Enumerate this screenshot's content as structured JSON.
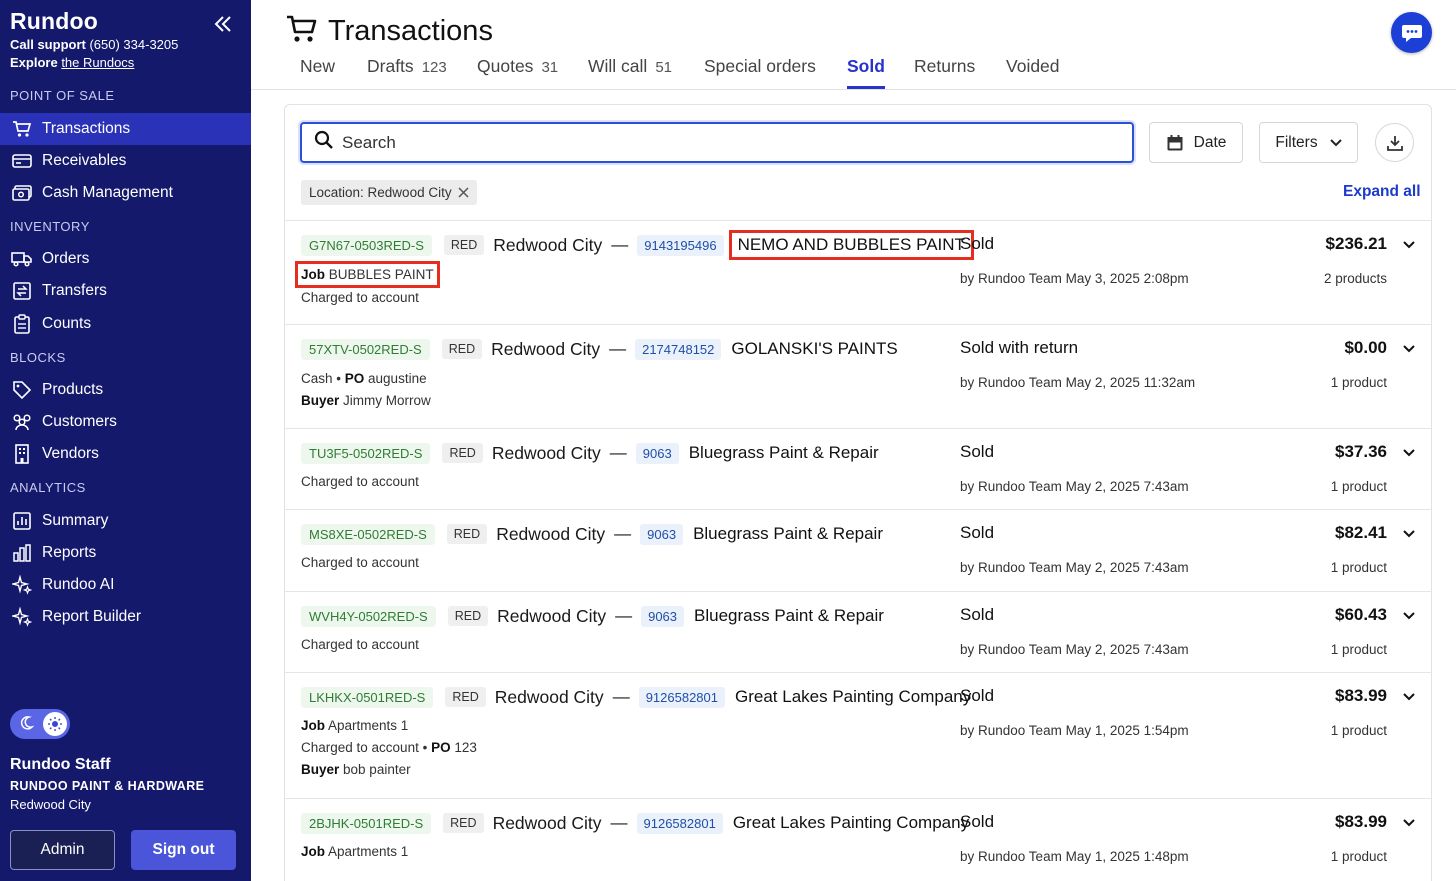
{
  "sidebar": {
    "brand": "Rundoo",
    "support_label": "Call support",
    "support_phone": "(650) 334-3205",
    "explore_label": "Explore",
    "explore_link": "the Rundocs",
    "sections": {
      "pos": "POINT OF SALE",
      "inventory": "INVENTORY",
      "blocks": "BLOCKS",
      "analytics": "ANALYTICS"
    },
    "items": {
      "transactions": "Transactions",
      "receivables": "Receivables",
      "cash": "Cash Management",
      "orders": "Orders",
      "transfers": "Transfers",
      "counts": "Counts",
      "products": "Products",
      "customers": "Customers",
      "vendors": "Vendors",
      "summary": "Summary",
      "reports": "Reports",
      "ai": "Rundoo AI",
      "builder": "Report Builder"
    },
    "user": {
      "name": "Rundoo Staff",
      "company": "RUNDOO PAINT & HARDWARE",
      "location": "Redwood City"
    },
    "admin_label": "Admin",
    "signout_label": "Sign out"
  },
  "header": {
    "title": "Transactions",
    "tabs": [
      {
        "label": "New",
        "count": ""
      },
      {
        "label": "Drafts",
        "count": "123"
      },
      {
        "label": "Quotes",
        "count": "31"
      },
      {
        "label": "Will call",
        "count": "51"
      },
      {
        "label": "Special orders",
        "count": ""
      },
      {
        "label": "Sold",
        "count": ""
      },
      {
        "label": "Returns",
        "count": ""
      },
      {
        "label": "Voided",
        "count": ""
      }
    ]
  },
  "toolbar": {
    "search_placeholder": "Search",
    "date_label": "Date",
    "filters_label": "Filters",
    "chip_label": "Location: Redwood City",
    "expand_label": "Expand all"
  },
  "rows": [
    {
      "id": "G7N67-0503RED-S",
      "loc_code": "RED",
      "loc_name": "Redwood City",
      "acct": "9143195496",
      "customer": "NEMO AND BUBBLES PAINT",
      "line1_label": "Job",
      "line1_value": "BUBBLES PAINT",
      "line2": "Charged to account",
      "status": "Sold",
      "byline": "by Rundoo Team May 3, 2025 2:08pm",
      "amount": "$236.21",
      "products": "2 products"
    },
    {
      "id": "57XTV-0502RED-S",
      "loc_code": "RED",
      "loc_name": "Redwood City",
      "acct": "2174748152",
      "customer": "GOLANSKI'S PAINTS",
      "line1_pre": "Cash • ",
      "line1_label": "PO",
      "line1_value": "augustine",
      "line2_label": "Buyer",
      "line2_value": "Jimmy Morrow",
      "status": "Sold with return",
      "byline": "by Rundoo Team May 2, 2025 11:32am",
      "amount": "$0.00",
      "products": "1 product"
    },
    {
      "id": "TU3F5-0502RED-S",
      "loc_code": "RED",
      "loc_name": "Redwood City",
      "acct": "9063",
      "customer": "Bluegrass Paint & Repair",
      "line1": "Charged to account",
      "status": "Sold",
      "byline": "by Rundoo Team May 2, 2025 7:43am",
      "amount": "$37.36",
      "products": "1 product"
    },
    {
      "id": "MS8XE-0502RED-S",
      "loc_code": "RED",
      "loc_name": "Redwood City",
      "acct": "9063",
      "customer": "Bluegrass Paint & Repair",
      "line1": "Charged to account",
      "status": "Sold",
      "byline": "by Rundoo Team May 2, 2025 7:43am",
      "amount": "$82.41",
      "products": "1 product"
    },
    {
      "id": "WVH4Y-0502RED-S",
      "loc_code": "RED",
      "loc_name": "Redwood City",
      "acct": "9063",
      "customer": "Bluegrass Paint & Repair",
      "line1": "Charged to account",
      "status": "Sold",
      "byline": "by Rundoo Team May 2, 2025 7:43am",
      "amount": "$60.43",
      "products": "1 product"
    },
    {
      "id": "LKHKX-0501RED-S",
      "loc_code": "RED",
      "loc_name": "Redwood City",
      "acct": "9126582801",
      "customer": "Great Lakes Painting Company",
      "line1_label": "Job",
      "line1_value": "Apartments 1",
      "line2_pre": "Charged to account • ",
      "line2_label": "PO",
      "line2_value": "123",
      "line3_label": "Buyer",
      "line3_value": "bob painter",
      "status": "Sold",
      "byline": "by Rundoo Team May 1, 2025 1:54pm",
      "amount": "$83.99",
      "products": "1 product"
    },
    {
      "id": "2BJHK-0501RED-S",
      "loc_code": "RED",
      "loc_name": "Redwood City",
      "acct": "9126582801",
      "customer": "Great Lakes Painting Company",
      "line1_label": "Job",
      "line1_value": "Apartments 1",
      "status": "Sold",
      "byline": "by Rundoo Team May 1, 2025 1:48pm",
      "amount": "$83.99",
      "products": "1 product"
    }
  ],
  "colors": {
    "sidebar_bg": "#14196b",
    "sidebar_active": "#2a33b8",
    "accent": "#2733c9",
    "highlight_box": "#e52e20",
    "id_tag_text": "#2e7d32"
  }
}
